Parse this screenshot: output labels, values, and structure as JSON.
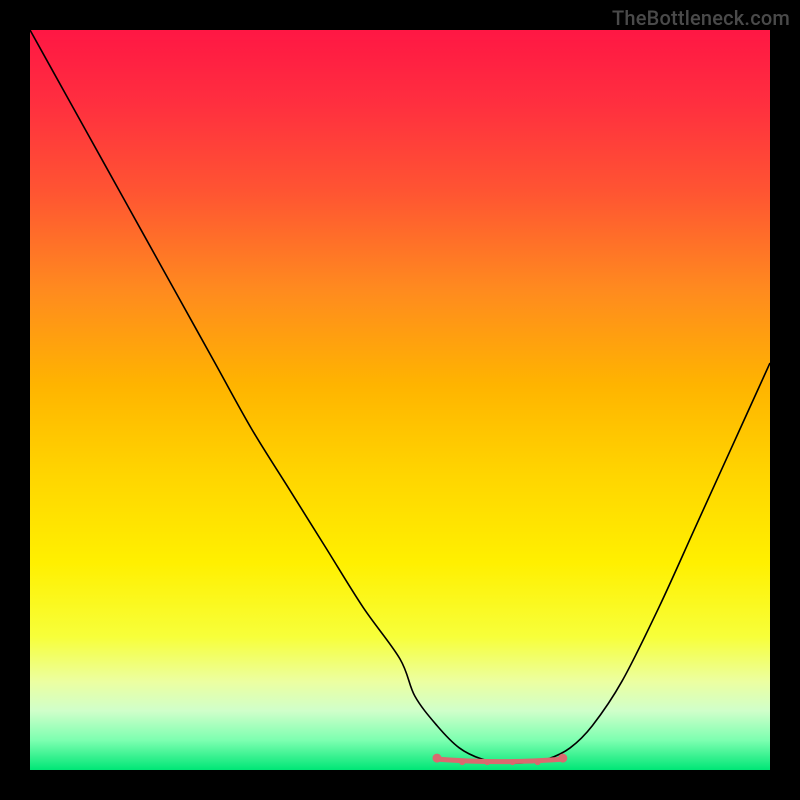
{
  "watermark": "TheBottleneck.com",
  "colors": {
    "marker": "#d96a6f",
    "curve": "#000000",
    "frame": "#000000"
  },
  "gradient_stops": [
    {
      "offset": 0.0,
      "color": "#ff1744"
    },
    {
      "offset": 0.1,
      "color": "#ff2f3f"
    },
    {
      "offset": 0.22,
      "color": "#ff5532"
    },
    {
      "offset": 0.35,
      "color": "#ff8a1f"
    },
    {
      "offset": 0.48,
      "color": "#ffb400"
    },
    {
      "offset": 0.6,
      "color": "#ffd500"
    },
    {
      "offset": 0.72,
      "color": "#fff000"
    },
    {
      "offset": 0.82,
      "color": "#f7ff3a"
    },
    {
      "offset": 0.88,
      "color": "#ecffa0"
    },
    {
      "offset": 0.92,
      "color": "#d0ffca"
    },
    {
      "offset": 0.96,
      "color": "#7cffb0"
    },
    {
      "offset": 1.0,
      "color": "#00e676"
    }
  ],
  "chart_data": {
    "type": "line",
    "title": "",
    "xlabel": "",
    "ylabel": "",
    "xlim": [
      0,
      100
    ],
    "ylim": [
      0,
      100
    ],
    "x": [
      0,
      5,
      10,
      15,
      20,
      25,
      30,
      35,
      40,
      45,
      50,
      52,
      55,
      58,
      61,
      64,
      67,
      70,
      73,
      76,
      80,
      85,
      90,
      95,
      100
    ],
    "values": [
      100,
      91,
      82,
      73,
      64,
      55,
      46,
      38,
      30,
      22,
      15,
      10,
      6,
      3,
      1.5,
      1,
      1,
      1.5,
      3,
      6,
      12,
      22,
      33,
      44,
      55
    ],
    "optimal_zone": {
      "x_start": 55,
      "x_end": 72,
      "y": 1.2
    }
  }
}
